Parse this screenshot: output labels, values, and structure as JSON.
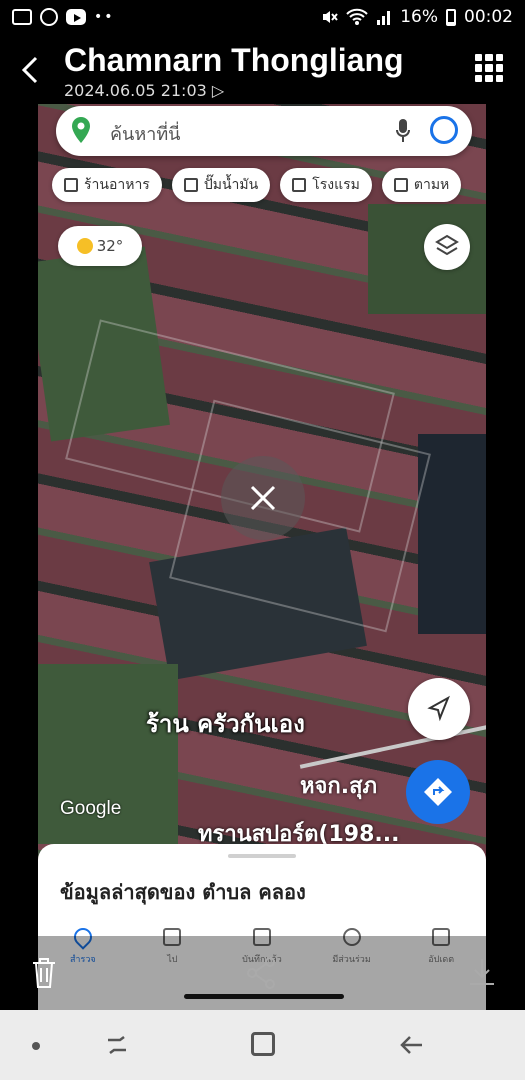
{
  "status_bar": {
    "battery": "16%",
    "time": "00:02",
    "notification_icons": [
      "gallery-icon",
      "line-icon",
      "youtube-icon"
    ],
    "system_icons": [
      "mute-icon",
      "wifi-icon",
      "signal-icon",
      "battery-icon"
    ]
  },
  "gallery": {
    "title": "Chamnarn Thongliang",
    "timestamp": "2024.06.05 21:03"
  },
  "maps": {
    "search_placeholder": "ค้นหาที่นี่",
    "chips": [
      {
        "label": "ร้านอาหาร",
        "icon": "restaurant-icon"
      },
      {
        "label": "ปั๊มน้ำมัน",
        "icon": "gas-station-icon"
      },
      {
        "label": "โรงแรม",
        "icon": "hotel-icon"
      },
      {
        "label": "ตามห",
        "icon": "shopping-icon"
      }
    ],
    "weather": "32°",
    "places": {
      "place1": "ร้าน ครัวกันเอง",
      "place2": "หจก.สุภ",
      "place3": "ทรานสปอร์ต(198..."
    },
    "google_logo": "Google",
    "sheet_title": "ข้อมูลล่าสุดของ ตำบล คลอง",
    "nav_items": [
      {
        "label": "สำรวจ",
        "active": true
      },
      {
        "label": "ไป",
        "active": false
      },
      {
        "label": "บันทึกแล้ว",
        "active": false
      },
      {
        "label": "มีส่วนร่วม",
        "active": false
      },
      {
        "label": "อัปเดต",
        "active": false
      }
    ]
  },
  "colors": {
    "accent": "#1a73e8",
    "field_red": "#6b3b44",
    "navbar_bg": "#ececec"
  }
}
